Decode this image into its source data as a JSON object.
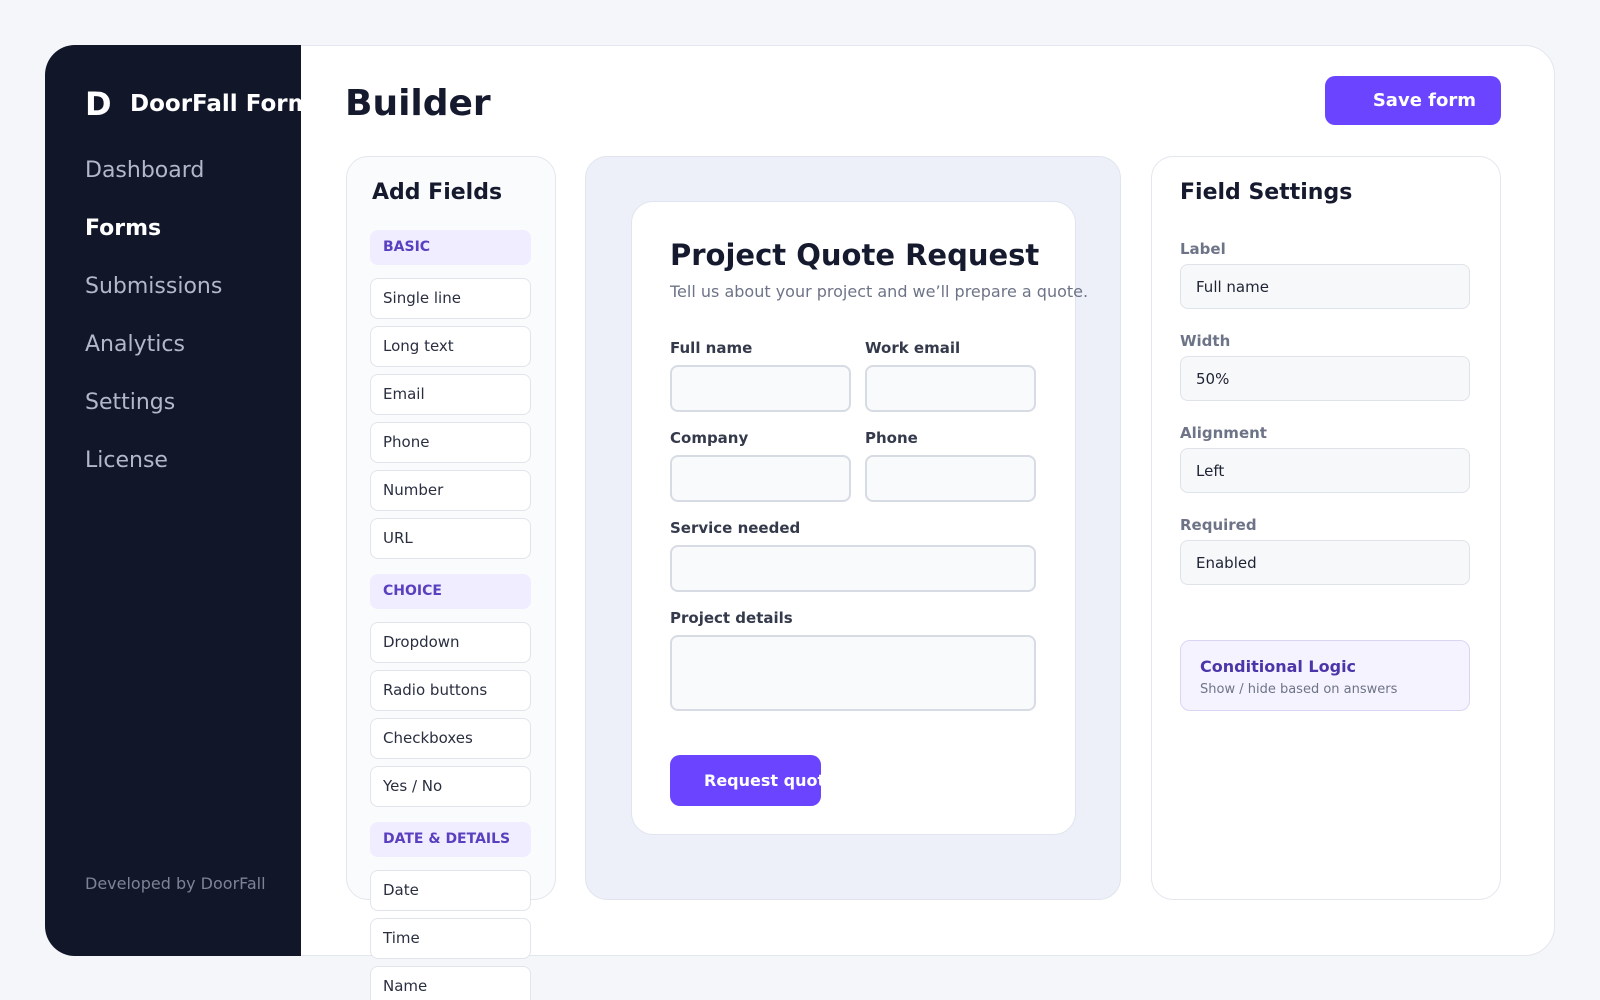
{
  "sidebar": {
    "logo": "D",
    "brand": "DoorFall Form",
    "items": [
      {
        "label": "Dashboard"
      },
      {
        "label": "Forms"
      },
      {
        "label": "Submissions"
      },
      {
        "label": "Analytics"
      },
      {
        "label": "Settings"
      },
      {
        "label": "License"
      }
    ],
    "active": "Forms",
    "footer": "Developed by DoorFall"
  },
  "header": {
    "title": "Builder",
    "save_label": "Save form"
  },
  "add_fields": {
    "title": "Add Fields",
    "categories": [
      {
        "name": "BASIC",
        "items": [
          "Single line",
          "Long text",
          "Email",
          "Phone",
          "Number",
          "URL"
        ]
      },
      {
        "name": "CHOICE",
        "items": [
          "Dropdown",
          "Radio buttons",
          "Checkboxes",
          "Yes / No"
        ]
      },
      {
        "name": "DATE & DETAILS",
        "items": [
          "Date",
          "Time",
          "Name"
        ]
      }
    ]
  },
  "form": {
    "title": "Project Quote Request",
    "description": "Tell us about your project and we’ll prepare a quote.",
    "fields": {
      "full_name": "Full name",
      "work_email": "Work email",
      "company": "Company",
      "phone": "Phone",
      "service": "Service needed",
      "details": "Project details"
    },
    "submit_label": "Request quote"
  },
  "settings": {
    "title": "Field Settings",
    "label_label": "Label",
    "label_value": "Full name",
    "width_label": "Width",
    "width_value": "50%",
    "alignment_label": "Alignment",
    "alignment_value": "Left",
    "required_label": "Required",
    "required_value": "Enabled",
    "logic_title": "Conditional Logic",
    "logic_subtitle": "Show / hide based on answers"
  },
  "colors": {
    "accent": "#6a44ff",
    "sidebar_bg": "#121629",
    "category_bg": "#efedff"
  }
}
